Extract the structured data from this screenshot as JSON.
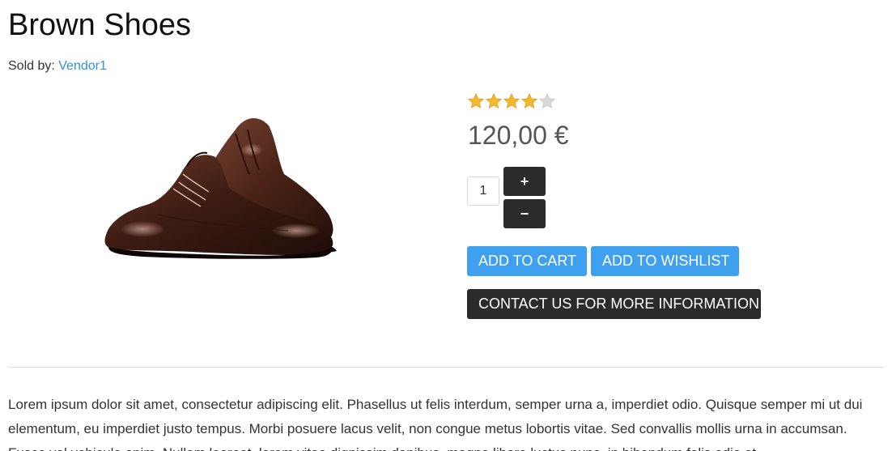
{
  "product": {
    "title": "Brown Shoes",
    "seller_prefix": "Sold by: ",
    "seller_name": "Vendor1",
    "rating": 4,
    "rating_max": 5,
    "price": "120,00 €",
    "quantity": "1",
    "image_icon": "brown-shoes-photo"
  },
  "actions": {
    "qty_plus": "+",
    "qty_minus": "−",
    "add_to_cart": "ADD TO CART",
    "add_to_wishlist": "ADD TO WISHLIST",
    "contact": "CONTACT US FOR MORE INFORMATION"
  },
  "description": "Lorem ipsum dolor sit amet, consectetur adipiscing elit. Phasellus ut felis interdum, semper urna a, imperdiet odio. Quisque semper mi ut dui elementum, eu imperdiet justo tempus. Morbi posuere lacus velit, non congue metus lobortis vitae. Sed convallis mollis urna in accumsan. Fusce vel vehicula enim. Nullam laoreet, lorem vitae dignissim dapibus, magna libero luctus nunc, in bibendum felis odio at",
  "colors": {
    "link": "#3a8fd8",
    "primary_button": "#40a0f0",
    "dark_button": "#2b2b2b",
    "star_filled": "#f5b82e",
    "star_empty": "#d9d9d9"
  }
}
